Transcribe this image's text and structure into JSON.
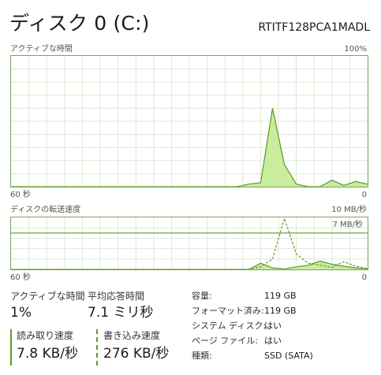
{
  "header": {
    "title": "ディスク 0 (C:)",
    "model": "RTITF128PCA1MADL"
  },
  "active_chart": {
    "label": "アクティブな時間",
    "max_label": "100%",
    "time_label": "60 秒",
    "min_label": "0"
  },
  "transfer_chart": {
    "label": "ディスクの転送速度",
    "max_label": "10 MB/秒",
    "line_label": "7 MB/秒",
    "time_label": "60 秒",
    "min_label": "0"
  },
  "stats": {
    "active_time_label": "アクティブな時間",
    "active_time_value": "1%",
    "avg_response_label": "平均応答時間",
    "avg_response_value": "7.1 ミリ秒",
    "read_speed_label": "読み取り速度",
    "read_speed_value": "7.8 KB/秒",
    "write_speed_label": "書き込み速度",
    "write_speed_value": "276 KB/秒"
  },
  "properties": [
    {
      "label": "容量:",
      "value": "119 GB"
    },
    {
      "label": "フォーマット済み:",
      "value": "119 GB"
    },
    {
      "label": "システム ディスク:",
      "value": "はい"
    },
    {
      "label": "ページ ファイル:",
      "value": "はい"
    },
    {
      "label": "種類:",
      "value": "SSD (SATA)"
    }
  ],
  "colors": {
    "accent": "#5a9a2a",
    "fill": "#c9ec9f",
    "grid": "#dfe8d6",
    "border": "#7aa35d"
  },
  "chart_data": [
    {
      "type": "area",
      "title": "アクティブな時間",
      "xlabel": "60 秒",
      "ylim": [
        0,
        100
      ],
      "x": [
        60,
        58,
        56,
        54,
        52,
        50,
        48,
        46,
        44,
        42,
        40,
        38,
        36,
        34,
        32,
        30,
        28,
        26,
        24,
        22,
        20,
        18,
        16,
        14,
        12,
        10,
        8,
        6,
        4,
        2,
        0
      ],
      "series": [
        {
          "values": [
            0,
            0,
            0,
            0,
            0,
            0,
            0,
            0,
            0,
            0,
            0,
            0,
            0,
            0,
            0,
            0,
            0,
            0,
            0,
            0,
            2,
            3,
            60,
            17,
            2,
            0,
            0,
            5,
            1,
            4,
            2
          ]
        }
      ]
    },
    {
      "type": "line",
      "title": "ディスクの転送速度",
      "xlabel": "60 秒",
      "ylim": [
        0,
        10
      ],
      "reference_label": "7 MB/秒",
      "reference_value": 7,
      "series": [
        {
          "name": "読み取り速度",
          "values": [
            0,
            0,
            0,
            0,
            0,
            0,
            0,
            0,
            0,
            0,
            0,
            0,
            0,
            0,
            0,
            0,
            0,
            0,
            0,
            0,
            0,
            1.2,
            0.3,
            0.1,
            0.5,
            0.8,
            1.6,
            1.0,
            0.6,
            0.3,
            0.1
          ]
        },
        {
          "name": "書き込み速度",
          "values": [
            0,
            0,
            0,
            0,
            0,
            0,
            0,
            0,
            0,
            0,
            0,
            0,
            0,
            0,
            0,
            0,
            0,
            0,
            0,
            0,
            0,
            0.5,
            2.0,
            9.8,
            3.0,
            1.2,
            0.8,
            0.4,
            1.5,
            0.6,
            0.2
          ]
        }
      ]
    }
  ]
}
